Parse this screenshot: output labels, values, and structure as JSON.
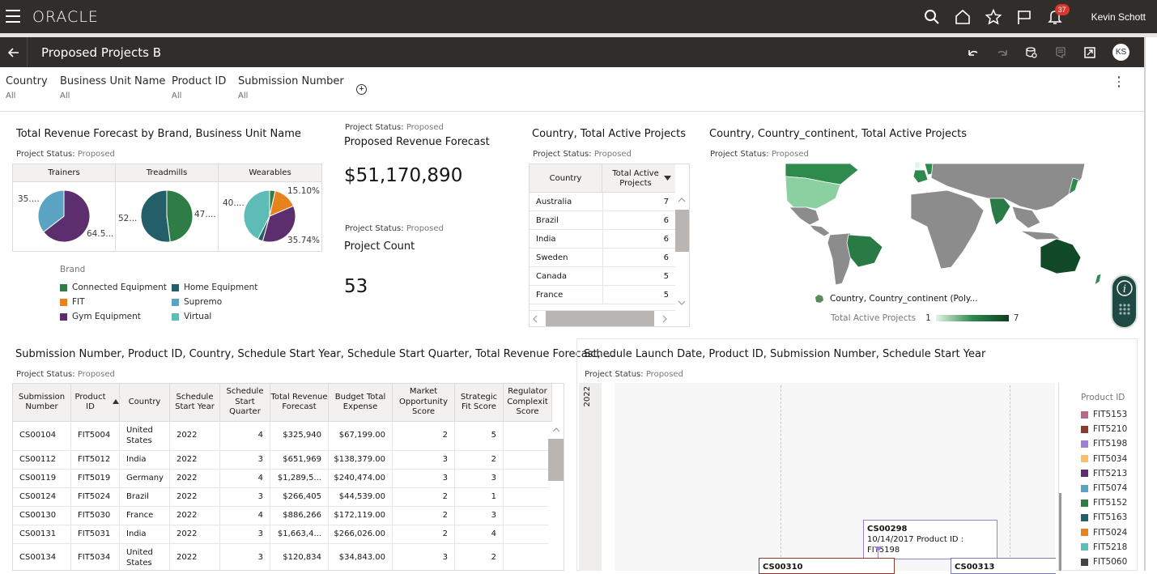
{
  "app": {
    "brand": "ORACLE",
    "user_name": "Kevin Schott",
    "notification_count": "37",
    "user_initials": "KS"
  },
  "page": {
    "title": "Proposed Projects B"
  },
  "filters": [
    {
      "label": "Country",
      "value": "All"
    },
    {
      "label": "Business Unit Name",
      "value": "All"
    },
    {
      "label": "Product ID",
      "value": "All"
    },
    {
      "label": "Submission Number",
      "value": "All"
    }
  ],
  "status_label": "Project Status:",
  "status_value": "Proposed",
  "pie_viz": {
    "title": "Total Revenue Forecast by Brand, Business Unit Name",
    "legend_title": "Brand",
    "brands": [
      {
        "name": "Connected Equipment",
        "color": "#2f7d46"
      },
      {
        "name": "Home Equipment",
        "color": "#245e68"
      },
      {
        "name": "FIT",
        "color": "#e8821d"
      },
      {
        "name": "Supremo",
        "color": "#5ba3c2"
      },
      {
        "name": "Gym Equipment",
        "color": "#5c2e6e"
      },
      {
        "name": "Virtual",
        "color": "#5dbcb6"
      }
    ],
    "panels": [
      {
        "name": "Trainers",
        "labels": [
          "35....",
          "64.5..."
        ],
        "slices": [
          {
            "brand": "Gym Equipment",
            "pct": 64.5
          },
          {
            "brand": "Supremo",
            "pct": 35.5
          }
        ]
      },
      {
        "name": "Treadmills",
        "labels": [
          "52...",
          "47...."
        ],
        "slices": [
          {
            "brand": "Connected Equipment",
            "pct": 47.9
          },
          {
            "brand": "Home Equipment",
            "pct": 52.1
          }
        ]
      },
      {
        "name": "Wearables",
        "labels": [
          "40....",
          "15.10%",
          "35.74%"
        ],
        "slices": [
          {
            "brand": "Connected Equipment",
            "pct": 3.5
          },
          {
            "brand": "FIT",
            "pct": 15.1
          },
          {
            "brand": "Gym Equipment",
            "pct": 35.74
          },
          {
            "brand": "Home Equipment",
            "pct": 3.2
          },
          {
            "brand": "Virtual",
            "pct": 42.46
          }
        ]
      }
    ]
  },
  "kpi_revenue": {
    "title": "Proposed Revenue Forecast",
    "value": "$51,170,890"
  },
  "kpi_count": {
    "title": "Project Count",
    "value": "53"
  },
  "country_table": {
    "title": "Country, Total Active Projects",
    "headers": [
      "Country",
      "Total Active Projects"
    ],
    "rows": [
      [
        "Australia",
        "7"
      ],
      [
        "Brazil",
        "6"
      ],
      [
        "India",
        "6"
      ],
      [
        "Sweden",
        "6"
      ],
      [
        "Canada",
        "5"
      ],
      [
        "France",
        "5"
      ]
    ]
  },
  "map_viz": {
    "title": "Country, Country_continent, Total Active Projects",
    "layer_legend": "Country, Country_continent (Poly...",
    "gradient_label": "Total Active Projects",
    "gradient_min": "1",
    "gradient_max": "7"
  },
  "detail_table": {
    "title": "Submission Number, Product ID, Country, Schedule Start Year, Schedule Start Quarter, Total Revenue Forecast, ...",
    "headers": [
      "Submission Number",
      "Product ID",
      "Country",
      "Schedule Start Year",
      "Schedule Start Quarter",
      "Total Revenue Forecast",
      "Budget Total Expense",
      "Market Opportunity Score",
      "Strategic Fit Score",
      "Regulator Complexit Score"
    ],
    "rows": [
      [
        "CS00104",
        "FIT5004",
        "United States",
        "2022",
        "4",
        "$325,940",
        "$67,199.00",
        "2",
        "5",
        ""
      ],
      [
        "CS00112",
        "FIT5012",
        "India",
        "2022",
        "3",
        "$651,969",
        "$138,379.00",
        "3",
        "2",
        ""
      ],
      [
        "CS00119",
        "FIT5019",
        "Germany",
        "2022",
        "4",
        "$1,289,5...",
        "$240,474.00",
        "3",
        "3",
        ""
      ],
      [
        "CS00124",
        "FIT5024",
        "Brazil",
        "2022",
        "3",
        "$266,405",
        "$44,539.00",
        "2",
        "1",
        ""
      ],
      [
        "CS00130",
        "FIT5030",
        "France",
        "2022",
        "4",
        "$886,266",
        "$172,119.00",
        "2",
        "3",
        ""
      ],
      [
        "CS00131",
        "FIT5031",
        "India",
        "2022",
        "3",
        "$1,663,4...",
        "$266,026.00",
        "2",
        "4",
        ""
      ],
      [
        "CS00134",
        "FIT5034",
        "United States",
        "2022",
        "3",
        "$120,834",
        "$34,843.00",
        "3",
        "2",
        ""
      ]
    ]
  },
  "timeline_viz": {
    "title": "Schedule Launch Date, Product ID, Submission Number, Schedule Start Year",
    "year_label": "2022",
    "callouts": [
      {
        "id": "CS00298",
        "detail": "10/14/2017 Product ID : FIT5198",
        "color": "#9d7fd6"
      },
      {
        "id": "CS00310",
        "detail": "",
        "color": "#8a3b2c"
      },
      {
        "id": "CS00313",
        "detail": "",
        "color": "#7f7bb8"
      }
    ],
    "legend_title": "Product ID",
    "legend": [
      {
        "name": "FIT5153",
        "color": "#b5698a"
      },
      {
        "name": "FIT5210",
        "color": "#8a3b2c"
      },
      {
        "name": "FIT5198",
        "color": "#9d7fd6"
      },
      {
        "name": "FIT5034",
        "color": "#fbbf6a"
      },
      {
        "name": "FIT5213",
        "color": "#5c2e6e"
      },
      {
        "name": "FIT5074",
        "color": "#5ba3c2"
      },
      {
        "name": "FIT5152",
        "color": "#2f7d46"
      },
      {
        "name": "FIT5163",
        "color": "#245e68"
      },
      {
        "name": "FIT5024",
        "color": "#e8821d"
      },
      {
        "name": "FIT5218",
        "color": "#5dbcb6"
      },
      {
        "name": "FIT5060",
        "color": "#444444"
      }
    ]
  }
}
